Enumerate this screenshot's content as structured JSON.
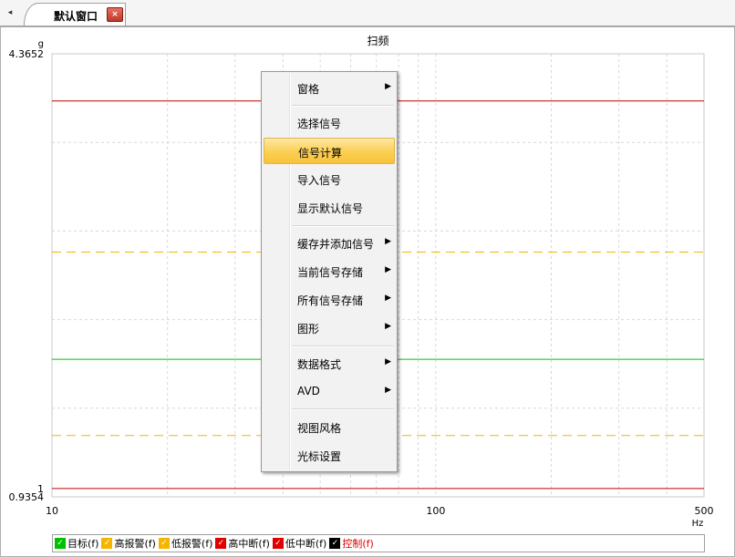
{
  "tabs": {
    "nav_arrow": "◂",
    "active_label": "默认窗口",
    "close_glyph": "×"
  },
  "chart_data": {
    "type": "line",
    "title": "扫频",
    "ylabel": "g",
    "xlabel": "Hz",
    "x_scale": "log",
    "xlim": [
      10,
      500
    ],
    "ylim": [
      0.9354,
      4.3652
    ],
    "x_tick_labels": [
      "10",
      "100",
      "500"
    ],
    "y_tick_labels": [
      "4.3652",
      "1",
      "0.9354"
    ],
    "grid": true,
    "legend_position": "bottom",
    "series": [
      {
        "name": "目标(f)",
        "color": "#00c000",
        "style": "solid",
        "x": [
          10,
          500
        ],
        "y": [
          2.0,
          2.0
        ]
      },
      {
        "name": "高报警(f)",
        "color": "#f5b400",
        "style": "dashed",
        "x": [
          10,
          500
        ],
        "y": [
          2.83,
          2.83
        ]
      },
      {
        "name": "低报警(f)",
        "color": "#f5b400",
        "style": "dashed",
        "x": [
          10,
          500
        ],
        "y": [
          1.41,
          1.41
        ]
      },
      {
        "name": "高中断(f)",
        "color": "#c00000",
        "style": "solid",
        "x": [
          10,
          500
        ],
        "y": [
          4.0,
          4.0
        ]
      },
      {
        "name": "低中断(f)",
        "color": "#c00000",
        "style": "solid",
        "x": [
          10,
          500
        ],
        "y": [
          1.0,
          1.0
        ]
      }
    ]
  },
  "legend": {
    "items": [
      {
        "label": "目标(f)",
        "color": "#00c000",
        "text_color": "#000000"
      },
      {
        "label": "高报警(f)",
        "color": "#f5b400",
        "text_color": "#000000"
      },
      {
        "label": "低报警(f)",
        "color": "#f5b400",
        "text_color": "#000000"
      },
      {
        "label": "高中断(f)",
        "color": "#e00000",
        "text_color": "#000000"
      },
      {
        "label": "低中断(f)",
        "color": "#e00000",
        "text_color": "#000000"
      },
      {
        "label": "控制(f)",
        "color": "#000000",
        "text_color": "#e00000"
      }
    ]
  },
  "context_menu": {
    "items": [
      {
        "label": "窗格",
        "submenu": true
      },
      {
        "label": "选择信号",
        "submenu": false
      },
      {
        "label": "信号计算",
        "submenu": false,
        "highlighted": true
      },
      {
        "label": "导入信号",
        "submenu": false
      },
      {
        "label": "显示默认信号",
        "submenu": false
      },
      {
        "label": "缓存并添加信号",
        "submenu": true
      },
      {
        "label": "当前信号存储",
        "submenu": true
      },
      {
        "label": "所有信号存储",
        "submenu": true
      },
      {
        "label": "图形",
        "submenu": true
      },
      {
        "label": "数据格式",
        "submenu": true
      },
      {
        "label": "AVD",
        "submenu": true
      },
      {
        "label": "视图风格",
        "submenu": false
      },
      {
        "label": "光标设置",
        "submenu": false
      }
    ],
    "submenu_arrow": "▶"
  }
}
